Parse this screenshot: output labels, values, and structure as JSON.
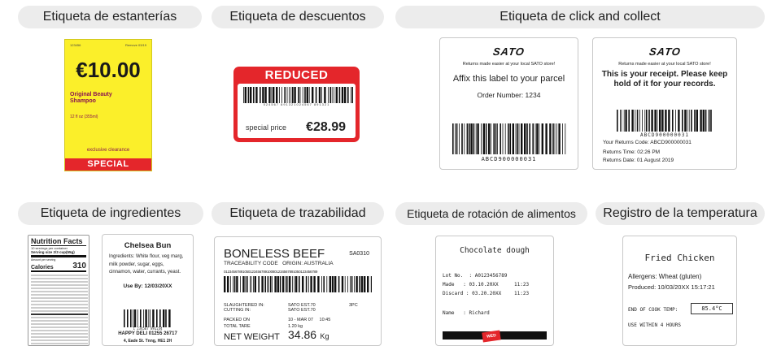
{
  "categories": {
    "shelf": "Etiqueta de estanterías",
    "discount": "Etiqueta de descuentos",
    "click_collect": "Etiqueta de click and collect",
    "ingredients": "Etiqueta de ingredientes",
    "traceability": "Etiqueta de trazabilidad",
    "rotation": "Etiqueta de rotación de alimentos",
    "temperature": "Registro de la temperatura"
  },
  "shelf_label": {
    "code": "123456",
    "promo": "Remove 03/19",
    "price": "€10.00",
    "product": "Original Beauty Shampoo",
    "size": "12 fl oz (355ml)",
    "offer": "exclusive clearance",
    "banner": "SPECIAL"
  },
  "discount_label": {
    "header": "REDUCED",
    "barcode_digits": "024567 891321024567 891321",
    "caption": "special price",
    "price": "€28.99"
  },
  "click_collect_1": {
    "brand": "SATO",
    "tagline": "Returns made easier at your local SATO store!",
    "instruction": "Affix this label to your parcel",
    "order": "Order Number: 1234",
    "barcode_text": "ABCD900000031"
  },
  "click_collect_2": {
    "brand": "SATO",
    "tagline": "Returns made easier at your local SATO store!",
    "receipt": "This is your receipt. Please keep hold of it for your records.",
    "barcode_text": "ABCD900000031",
    "code_line": "Your Returns Code: ABCD900000031",
    "time_line": "Returns Time: 02:26 PM",
    "date_line": "Returns Date: 01 August 2019"
  },
  "nutrition": {
    "title": "Nutrition Facts",
    "servings": "10 servings per container",
    "serving_size": "Serving size   2/3 cup(55g)",
    "per_serving": "Amount per serving",
    "calories_label": "Calories",
    "calories": "310"
  },
  "ingredients_label": {
    "title": "Chelsea Bun",
    "text": "Ingredients: White flour, veg marg, milk powder, sugar, eggs, cinnamon, water, currants, yeast.",
    "use_by": "Use By: 12/03/20XX",
    "barcode_text": "1 234567 891234",
    "shop": "HAPPY DELI 01255 26717",
    "address": "4, Eade St. Tnng, HE1 2H"
  },
  "trace_label": {
    "title": "BONELESS BEEF",
    "code": "SA0310",
    "sub": "TRACEABILITY CODE   ORIGIN: AUSTRALIA",
    "barcode_text": "01234567891050123456789100801234567891050123456789",
    "slaughtered": "SLAUGHTERED IN:",
    "cutting": "CUTTING IN:",
    "sato1": "SATO EST.70",
    "sato2": "SATO EST.70",
    "pc": "3PC",
    "packed_on": "PACKED ON",
    "packed_val": "10 - MAR 07     10:45",
    "tare": "TOTAL TARE",
    "tare_val": "1.20 kg",
    "net": "NET WEIGHT",
    "net_val": "34.86",
    "net_unit": "Kg"
  },
  "rotation_label": {
    "title": "Chocolate dough",
    "lot": "Lot No.  : A0123456789",
    "made": "Made   : 03.10.20XX",
    "made_time": "11:23",
    "discard": "Discard : 03.20.20XX",
    "discard_time": "11:23",
    "name": "Name   : Richard",
    "day": "WED"
  },
  "temperature_label": {
    "title": "Fried Chicken",
    "allergens": "Allergens: Wheat (gluten)",
    "produced": "Produced: 10/03/20XX 15:17:21",
    "temp_label": "END OF COOK TEMP:",
    "temp_val": "85.4°C",
    "use_within": "USE WITHIN 4 HOURS"
  },
  "colors": {
    "pill": "#ececec",
    "red": "#e4262b",
    "yellow": "#fbef2a",
    "magenta": "#8a1450"
  }
}
